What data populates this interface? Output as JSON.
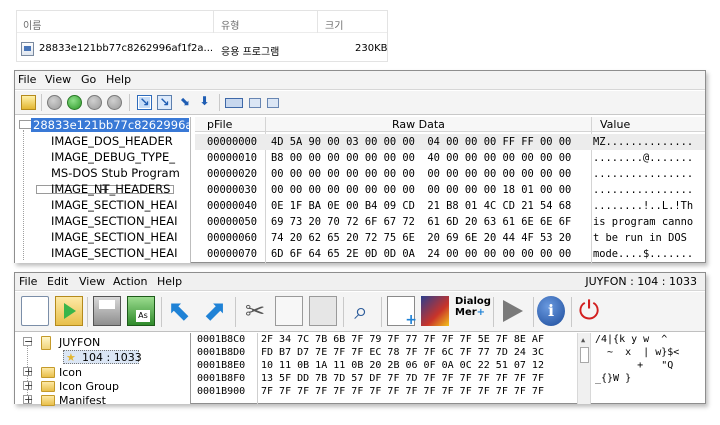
{
  "explorer": {
    "columns": [
      "이름",
      "유형",
      "크기"
    ],
    "file": {
      "name": "28833e121bb77c8262996af1f2a...",
      "type": "응용 프로그램",
      "size": "230KB"
    }
  },
  "win1": {
    "menu": [
      "File",
      "View",
      "Go",
      "Help"
    ],
    "tree": [
      "28833e121bb77c8262996af",
      "IMAGE_DOS_HEADER",
      "IMAGE_DEBUG_TYPE_",
      "MS-DOS Stub Program",
      "IMAGE_NT_HEADERS",
      "IMAGE_SECTION_HEAI",
      "IMAGE_SECTION_HEAI",
      "IMAGE_SECTION_HEAI",
      "IMAGE_SECTION_HEAI"
    ],
    "headers": {
      "pfile": "pFile",
      "raw": "Raw Data",
      "value": "Value"
    },
    "rows": [
      {
        "pfile": "00000000",
        "raw": "4D 5A 90 00 03 00 00 00  04 00 00 00 FF FF 00 00",
        "value": "MZ.............."
      },
      {
        "pfile": "00000010",
        "raw": "B8 00 00 00 00 00 00 00  40 00 00 00 00 00 00 00",
        "value": "........@......."
      },
      {
        "pfile": "00000020",
        "raw": "00 00 00 00 00 00 00 00  00 00 00 00 00 00 00 00",
        "value": "................"
      },
      {
        "pfile": "00000030",
        "raw": "00 00 00 00 00 00 00 00  00 00 00 00 18 01 00 00",
        "value": "................"
      },
      {
        "pfile": "00000040",
        "raw": "0E 1F BA 0E 00 B4 09 CD  21 B8 01 4C CD 21 54 68",
        "value": "........!..L.!Th"
      },
      {
        "pfile": "00000050",
        "raw": "69 73 20 70 72 6F 67 72  61 6D 20 63 61 6E 6E 6F",
        "value": "is program canno"
      },
      {
        "pfile": "00000060",
        "raw": "74 20 62 65 20 72 75 6E  20 69 6E 20 44 4F 53 20",
        "value": "t be run in DOS "
      },
      {
        "pfile": "00000070",
        "raw": "6D 6F 64 65 2E 0D 0D 0A  24 00 00 00 00 00 00 00",
        "value": "mode....$......."
      }
    ]
  },
  "win2": {
    "menu": [
      "File",
      "Edit",
      "View",
      "Action",
      "Help"
    ],
    "status": "JUYFON : 104 : 1033",
    "toolbar": {
      "dialog_label_1": "Dialog",
      "dialog_label_2": "Mer"
    },
    "tree": {
      "root": "JUYFON",
      "child": "104 : 1033",
      "items": [
        "Icon",
        "Icon Group",
        "Manifest"
      ]
    },
    "hex": {
      "addresses": [
        "0001B8C0",
        "0001B8D0",
        "0001B8E0",
        "0001B8F0",
        "0001B900"
      ],
      "bytes": [
        "2F 34 7C 7B 6B 7F 79 7F 77 7F 7F 7F 5E 7F 8E AF",
        "FD B7 D7 7E 7F 7F EC 78 7F 7F 6C 7F 77 7D 24 3C",
        "10 11 0B 1A 11 0B 20 2B 06 0F 0A 0C 22 51 07 12",
        "13 5F DD 7B 7D 57 DF 7F 7D 7F 7F 7F 7F 7F 7F 7F",
        "7F 7F 7F 7F 7F 7F 7F 7F 7F 7F 7F 7F 7F 7F 7F 7F"
      ],
      "ascii": [
        "/4|{k y w  ^",
        "  ~  x  | w}$<",
        "       +   \"Q",
        "_{}W }",
        ""
      ]
    }
  }
}
